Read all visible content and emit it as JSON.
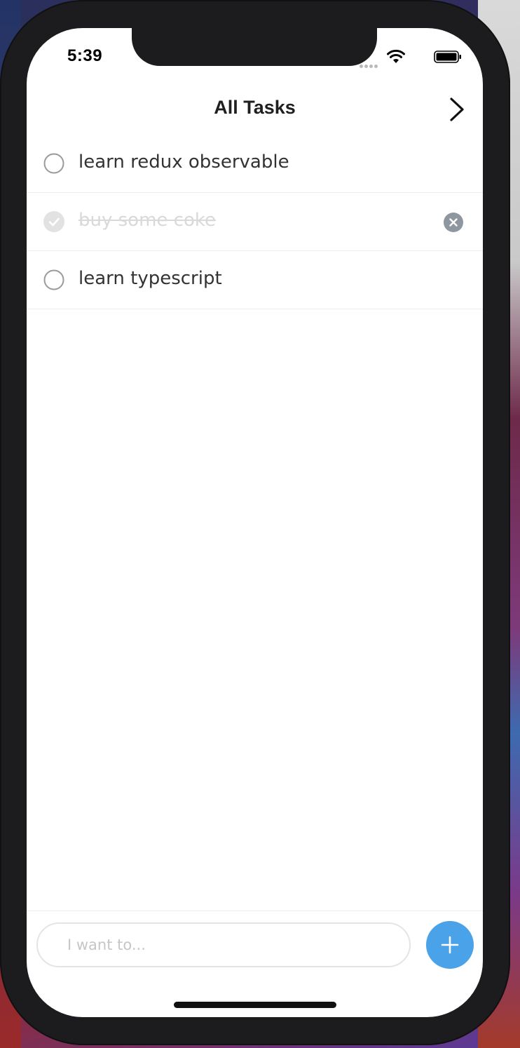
{
  "status_bar": {
    "time": "5:39"
  },
  "nav": {
    "title": "All Tasks",
    "forward_icon": "chevron-right-icon"
  },
  "tasks": [
    {
      "label": "learn redux observable",
      "completed": false
    },
    {
      "label": "buy some coke",
      "completed": true
    },
    {
      "label": "learn typescript",
      "completed": false
    }
  ],
  "composer": {
    "placeholder": "I want to...",
    "value": "",
    "add_icon": "plus-icon"
  },
  "colors": {
    "accent": "#4aa3e8",
    "text": "#333333",
    "done_text": "#d9d9d9",
    "delete_badge": "#8e96a0"
  }
}
